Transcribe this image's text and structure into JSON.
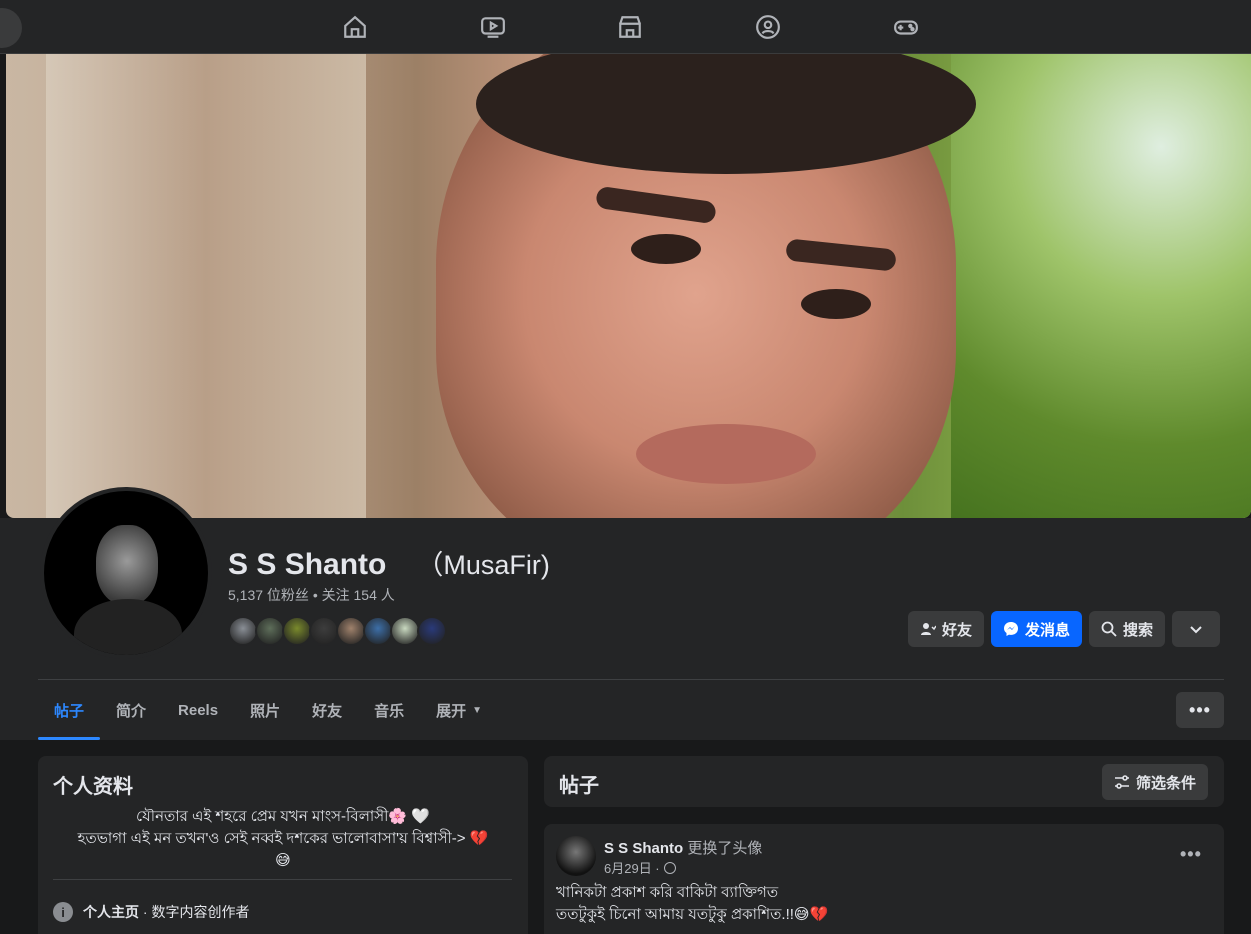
{
  "nav": {
    "icons": [
      "home-icon",
      "video-icon",
      "marketplace-icon",
      "groups-icon",
      "gaming-icon"
    ]
  },
  "profile": {
    "name": "S S Shanto",
    "alt_name": "（MusaFir)",
    "stats": "5,137 位粉丝 • 关注 154 人",
    "friend_colors": [
      "#8a8f96",
      "#5e6e5a",
      "#7a8a2c",
      "#3d3d3d",
      "#a0826c",
      "#3d6fa8",
      "#c9d9c0",
      "#2a3a7a"
    ]
  },
  "actions": {
    "friends_label": "好友",
    "message_label": "发消息",
    "search_label": "搜索"
  },
  "tabs": [
    {
      "label": "帖子",
      "active": true
    },
    {
      "label": "简介"
    },
    {
      "label": "Reels"
    },
    {
      "label": "照片"
    },
    {
      "label": "好友"
    },
    {
      "label": "音乐"
    },
    {
      "label": "展开"
    }
  ],
  "more_label": "•••",
  "intro": {
    "title": "个人资料",
    "bio_line1": "যৌনতার এই শহরে প্রেম যখন মাংস-বিলাসী🌸 🤍",
    "bio_line2": "হতভাগা এই মন তখন'ও সেই নব্বই দশকের ভালোবাসা'য় বিশ্বাসী-> 💔",
    "bio_line3": "😅",
    "info_icon": "i",
    "page_label": "个人主页",
    "page_rest": " · 数字内容创作者"
  },
  "posts": {
    "title": "帖子",
    "filter_label": "筛选条件"
  },
  "post": {
    "author": "S S Shanto",
    "action": " 更换了头像",
    "date": "6月29日 ·",
    "more": "•••",
    "text_line1": "খানিকটা প্রকাশ করি বাকিটা ব্যাক্তিগত",
    "text_line2": "ততটুকুই চিনো আমায় যতটুকু প্রকাশিত.!!😅💔"
  },
  "colors": {
    "accent": "#0866ff",
    "tab_active": "#2d88ff",
    "card_bg": "#242526",
    "page_bg": "#18191a"
  }
}
